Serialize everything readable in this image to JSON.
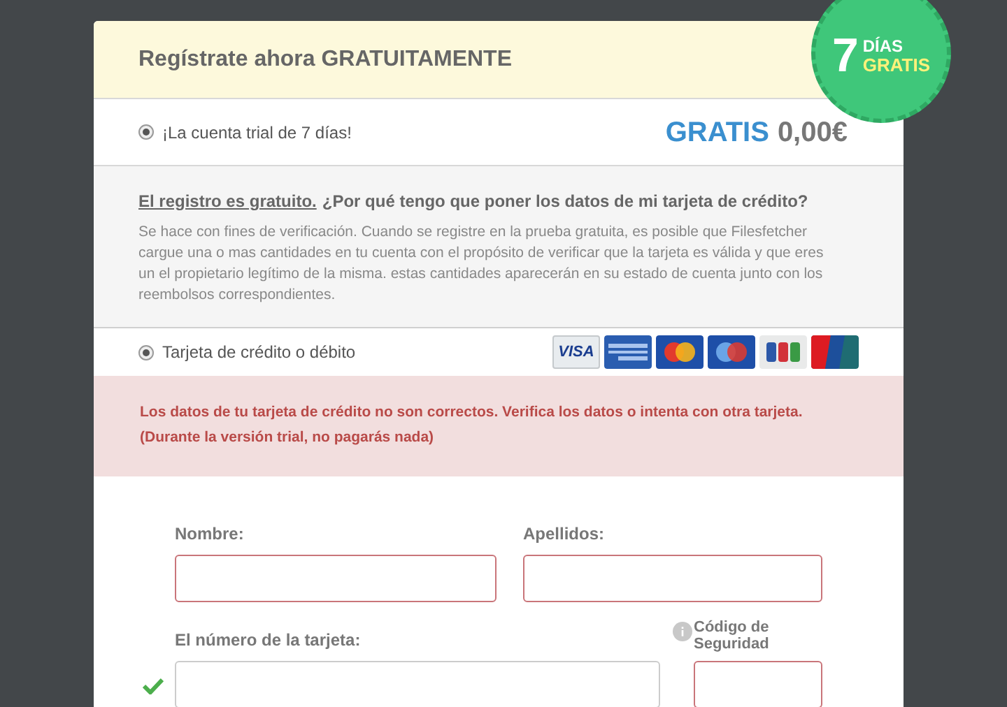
{
  "header": {
    "title": "Regístrate ahora GRATUITAMENTE"
  },
  "badge": {
    "number": "7",
    "line_1": "DÍAS",
    "line_2": "GRATIS"
  },
  "plan": {
    "label": "¡La cuenta trial de 7 días!",
    "selected": true,
    "price_label": "GRATIS",
    "price": "0,00€"
  },
  "info": {
    "link": "El registro es gratuito.",
    "question": "¿Por qué tengo que poner los datos de mi tarjeta de crédito?",
    "text": "Se hace con fines de verificación. Cuando se registre en la prueba gratuita, es posible que Filesfetcher cargue una o mas cantidades en tu cuenta con el propósito de verificar que la tarjeta es válida y que eres un el propietario legítimo de la misma. estas cantidades aparecerán en su estado de cuenta junto con los reembolsos correspondientes."
  },
  "payment": {
    "label": "Tarjeta de crédito o débito",
    "selected": true,
    "cards": [
      {
        "kind": "visa",
        "label": "VISA"
      },
      {
        "kind": "amex"
      },
      {
        "kind": "mastercard"
      },
      {
        "kind": "maestro"
      },
      {
        "kind": "jcb"
      },
      {
        "kind": "unionpay"
      }
    ]
  },
  "error": {
    "line_1": "Los datos de tu tarjeta de crédito no son correctos. Verifica los datos o intenta con otra tarjeta.",
    "line_2": "(Durante la versión trial, no pagarás nada)"
  },
  "form": {
    "first_name": {
      "label": "Nombre:",
      "invalid": true
    },
    "last_name": {
      "label": "Apellidos:",
      "invalid": true
    },
    "card_number": {
      "label": "El número de la tarjeta:",
      "invalid": false,
      "valid": true
    },
    "security_code": {
      "label": "Código de Seguridad",
      "invalid": true
    }
  }
}
